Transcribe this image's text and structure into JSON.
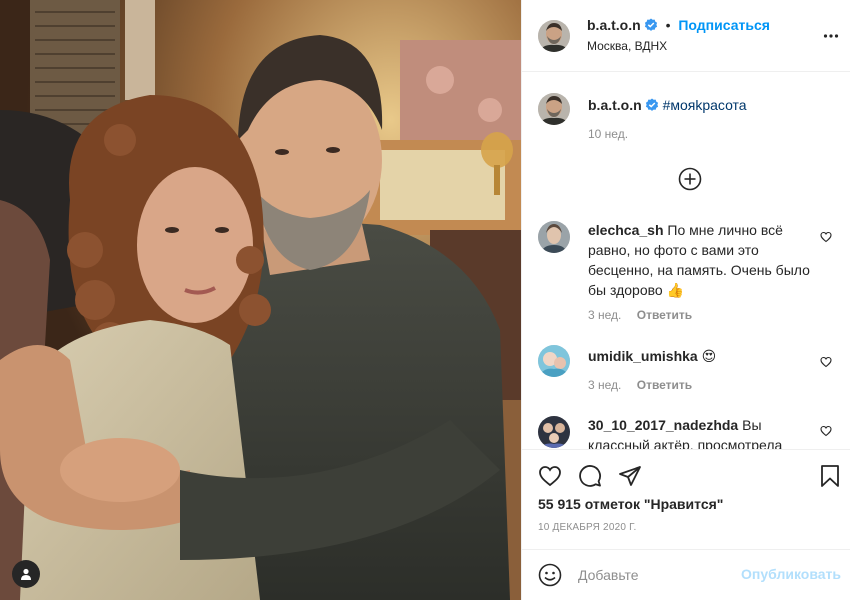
{
  "post": {
    "author": "b.a.t.o.n",
    "follow_label": "Подписаться",
    "location": "Москва, ВДНХ",
    "caption_hashtag": "#мояkрасота",
    "caption_time": "10 нед.",
    "likes_text": "55 915 отметок \"Нравится\"",
    "date": "10 декабря 2020 г."
  },
  "comments": [
    {
      "user": "elechca_sh",
      "text": "По мне лично всё равно, но фото с вами это бесценно, на память. Очень было бы здорово 👍",
      "time": "3 нед.",
      "reply_label": "Ответить"
    },
    {
      "user": "umidik_umishka",
      "text": "😍",
      "time": "3 нед.",
      "reply_label": "Ответить"
    },
    {
      "user": "30_10_2017_nadezhda",
      "text": "Вы классный актёр, просмотрела",
      "time": "",
      "reply_label": ""
    }
  ],
  "composer": {
    "placeholder": "Добавьте",
    "publish_label": "Опубликовать"
  },
  "icons": {
    "verified": "verified-badge-icon",
    "more": "more-options-icon",
    "load_more": "plus-circle-icon",
    "like": "heart-icon",
    "comment": "comment-icon",
    "share": "send-icon",
    "save": "bookmark-icon",
    "emoji": "smiley-icon",
    "tag": "user-tag-icon"
  },
  "colors": {
    "accent": "#0095f6",
    "hashtag": "#00376b",
    "muted": "#8e8e8e",
    "publish_disabled": "#b2dffc"
  }
}
